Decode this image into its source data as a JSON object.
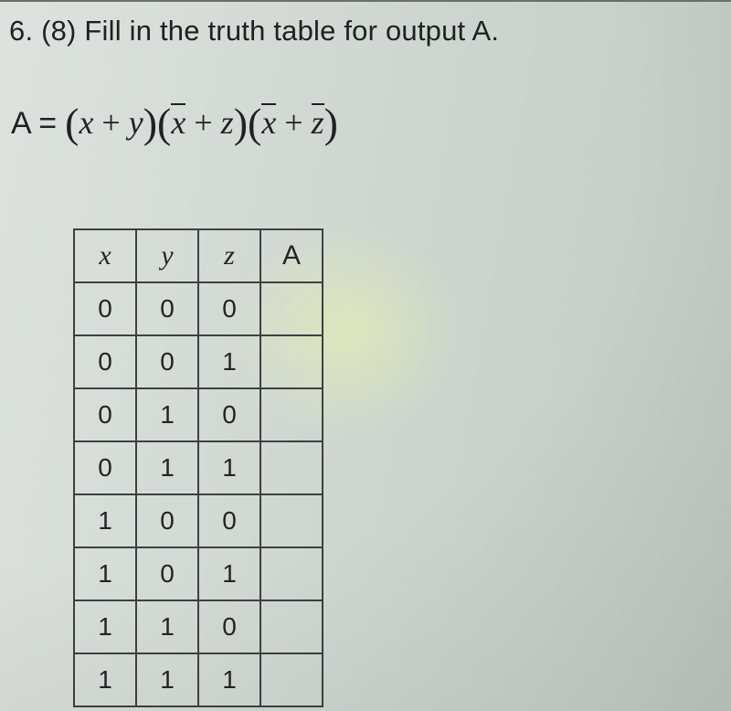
{
  "question": {
    "number": "6.",
    "points": "(8)",
    "prompt": "Fill in the truth table for output A."
  },
  "formula": {
    "lhs": "A =",
    "term1_a": "x",
    "term1_op": "+",
    "term1_b": "y",
    "term2_a": "x",
    "term2_op": "+",
    "term2_b": "z",
    "term3_a": "x",
    "term3_op": "+",
    "term3_b": "z"
  },
  "table": {
    "headers": [
      "x",
      "y",
      "z",
      "A"
    ],
    "rows": [
      [
        "0",
        "0",
        "0",
        ""
      ],
      [
        "0",
        "0",
        "1",
        ""
      ],
      [
        "0",
        "1",
        "0",
        ""
      ],
      [
        "0",
        "1",
        "1",
        ""
      ],
      [
        "1",
        "0",
        "0",
        ""
      ],
      [
        "1",
        "0",
        "1",
        ""
      ],
      [
        "1",
        "1",
        "0",
        ""
      ],
      [
        "1",
        "1",
        "1",
        ""
      ]
    ]
  }
}
